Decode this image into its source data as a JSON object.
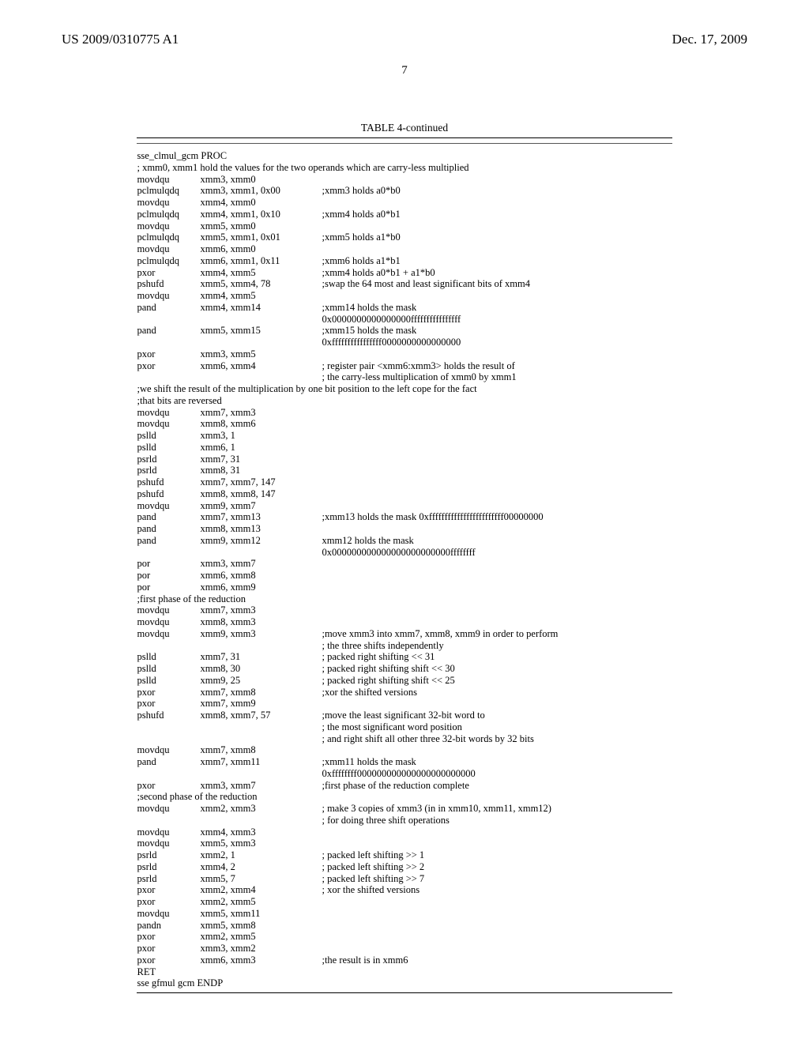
{
  "header": {
    "left": "US 2009/0310775 A1",
    "right": "Dec. 17, 2009"
  },
  "page_number": "7",
  "table_title": "TABLE 4-continued",
  "rows": [
    {
      "span": "sse_clmul_gcm PROC"
    },
    {
      "span": "; xmm0, xmm1 hold the values for the two operands which are carry-less multiplied"
    },
    {
      "inst": "movdqu",
      "ops": "xmm3, xmm0",
      "com": ""
    },
    {
      "inst": "pclmulqdq",
      "ops": "xmm3, xmm1, 0x00",
      "com": ";xmm3 holds a0*b0"
    },
    {
      "inst": "movdqu",
      "ops": "xmm4, xmm0",
      "com": ""
    },
    {
      "inst": "pclmulqdq",
      "ops": "xmm4, xmm1, 0x10",
      "com": ";xmm4 holds a0*b1"
    },
    {
      "inst": "movdqu",
      "ops": "xmm5, xmm0",
      "com": ""
    },
    {
      "inst": "pclmulqdq",
      "ops": "xmm5, xmm1, 0x01",
      "com": ";xmm5 holds a1*b0"
    },
    {
      "inst": "movdqu",
      "ops": "xmm6, xmm0",
      "com": ""
    },
    {
      "inst": "pclmulqdq",
      "ops": "xmm6, xmm1, 0x11",
      "com": ";xmm6 holds a1*b1"
    },
    {
      "inst": "pxor",
      "ops": "xmm4, xmm5",
      "com": ";xmm4 holds a0*b1 + a1*b0"
    },
    {
      "inst": "pshufd",
      "ops": "xmm5, xmm4, 78",
      "com": ";swap the 64 most and least significant bits of xmm4"
    },
    {
      "inst": "movdqu",
      "ops": "xmm4, xmm5",
      "com": ""
    },
    {
      "inst": "pand",
      "ops": "xmm4, xmm14",
      "com": ";xmm14 holds the mask"
    },
    {
      "inst": "",
      "ops": "",
      "com": "0x0000000000000000ffffffffffffffff"
    },
    {
      "inst": "pand",
      "ops": "xmm5, xmm15",
      "com": ";xmm15 holds the mask"
    },
    {
      "inst": "",
      "ops": "",
      "com": "0xffffffffffffffff0000000000000000"
    },
    {
      "inst": "pxor",
      "ops": "xmm3, xmm5",
      "com": ""
    },
    {
      "inst": "pxor",
      "ops": "xmm6, xmm4",
      "com": "; register pair <xmm6:xmm3> holds the result of"
    },
    {
      "inst": "",
      "ops": "",
      "com": "; the carry-less multiplication of xmm0 by xmm1"
    },
    {
      "span": ";we shift the result of the multiplication by one bit position to the left cope for the fact"
    },
    {
      "span": ";that bits are reversed"
    },
    {
      "inst": "movdqu",
      "ops": "xmm7, xmm3",
      "com": ""
    },
    {
      "inst": "movdqu",
      "ops": "xmm8, xmm6",
      "com": ""
    },
    {
      "inst": "pslld",
      "ops": "xmm3, 1",
      "com": ""
    },
    {
      "inst": "pslld",
      "ops": "xmm6, 1",
      "com": ""
    },
    {
      "inst": "psrld",
      "ops": "xmm7, 31",
      "com": ""
    },
    {
      "inst": "psrld",
      "ops": "xmm8, 31",
      "com": ""
    },
    {
      "inst": "pshufd",
      "ops": "xmm7, xmm7, 147",
      "com": ""
    },
    {
      "inst": "pshufd",
      "ops": "xmm8, xmm8, 147",
      "com": ""
    },
    {
      "inst": "movdqu",
      "ops": "xmm9, xmm7",
      "com": ""
    },
    {
      "inst": "pand",
      "ops": "xmm7, xmm13",
      "com": ";xmm13 holds the mask 0xffffffffffffffffffffffff00000000"
    },
    {
      "inst": "pand",
      "ops": "xmm8, xmm13",
      "com": ""
    },
    {
      "inst": "pand",
      "ops": "xmm9, xmm12",
      "com": "xmm12 holds the mask"
    },
    {
      "inst": "",
      "ops": "",
      "com": "0x000000000000000000000000ffffffff"
    },
    {
      "inst": "por",
      "ops": "xmm3, xmm7",
      "com": ""
    },
    {
      "inst": "por",
      "ops": "xmm6, xmm8",
      "com": ""
    },
    {
      "inst": "por",
      "ops": "xmm6, xmm9",
      "com": ""
    },
    {
      "span": ";first phase of the reduction"
    },
    {
      "inst": "movdqu",
      "ops": "xmm7, xmm3",
      "com": ""
    },
    {
      "inst": "movdqu",
      "ops": "xmm8, xmm3",
      "com": ""
    },
    {
      "inst": "movdqu",
      "ops": "xmm9, xmm3",
      "com": ";move xmm3 into xmm7, xmm8, xmm9 in order to perform"
    },
    {
      "inst": "",
      "ops": "",
      "com": "; the three shifts independently"
    },
    {
      "inst": "pslld",
      "ops": "xmm7, 31",
      "com": "; packed right shifting << 31"
    },
    {
      "inst": "pslld",
      "ops": "xmm8, 30",
      "com": "; packed right shifting shift << 30"
    },
    {
      "inst": "pslld",
      "ops": "xmm9, 25",
      "com": "; packed right shifting shift << 25"
    },
    {
      "inst": "pxor",
      "ops": "xmm7, xmm8",
      "com": ";xor the shifted versions"
    },
    {
      "inst": "pxor",
      "ops": "xmm7, xmm9",
      "com": ""
    },
    {
      "inst": "pshufd",
      "ops": "xmm8, xmm7, 57",
      "com": ";move the least significant 32-bit word to"
    },
    {
      "inst": "",
      "ops": "",
      "com": "; the most significant word position"
    },
    {
      "inst": "",
      "ops": "",
      "com": "; and right shift all other three 32-bit words by 32 bits"
    },
    {
      "inst": "movdqu",
      "ops": "xmm7, xmm8",
      "com": ""
    },
    {
      "inst": "pand",
      "ops": "xmm7, xmm11",
      "com": ";xmm11 holds the mask"
    },
    {
      "inst": "",
      "ops": "",
      "com": "0xffffffff000000000000000000000000"
    },
    {
      "inst": "pxor",
      "ops": "xmm3, xmm7",
      "com": ";first phase of the reduction complete"
    },
    {
      "span": ";second phase of the reduction"
    },
    {
      "inst": "movdqu",
      "ops": "xmm2, xmm3",
      "com": "; make 3 copies of xmm3 (in in xmm10, xmm11, xmm12)"
    },
    {
      "inst": "",
      "ops": "",
      "com": "; for doing three shift operations"
    },
    {
      "inst": "movdqu",
      "ops": "xmm4, xmm3",
      "com": ""
    },
    {
      "inst": "movdqu",
      "ops": "xmm5, xmm3",
      "com": ""
    },
    {
      "inst": "psrld",
      "ops": "xmm2, 1",
      "com": "; packed left shifting >> 1"
    },
    {
      "inst": "psrld",
      "ops": "xmm4, 2",
      "com": "; packed left shifting >> 2"
    },
    {
      "inst": "psrld",
      "ops": "xmm5, 7",
      "com": "; packed left shifting >> 7"
    },
    {
      "inst": "pxor",
      "ops": "xmm2, xmm4",
      "com": "; xor the shifted versions"
    },
    {
      "inst": "pxor",
      "ops": "xmm2, xmm5",
      "com": ""
    },
    {
      "inst": "movdqu",
      "ops": "xmm5, xmm11",
      "com": ""
    },
    {
      "inst": "pandn",
      "ops": "xmm5, xmm8",
      "com": ""
    },
    {
      "inst": "pxor",
      "ops": "xmm2, xmm5",
      "com": ""
    },
    {
      "inst": "pxor",
      "ops": "xmm3, xmm2",
      "com": ""
    },
    {
      "inst": "pxor",
      "ops": "xmm6, xmm3",
      "com": ";the result is in xmm6"
    },
    {
      "inst": "RET",
      "ops": "",
      "com": ""
    },
    {
      "span": "sse gfmul gcm ENDP"
    }
  ]
}
